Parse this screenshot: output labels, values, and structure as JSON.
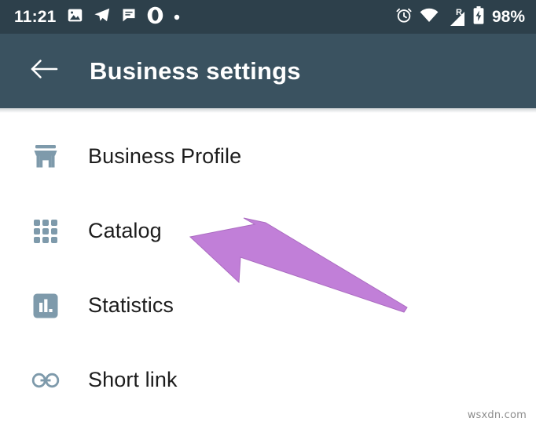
{
  "status_bar": {
    "time": "11:21",
    "battery_percent": "98%",
    "roaming_label": "R",
    "left_icons": [
      "photo-icon",
      "telegram-icon",
      "message-icon",
      "opera-icon",
      "dot-icon"
    ],
    "right_icons": [
      "alarm-icon",
      "wifi-icon",
      "signal-icon",
      "battery-charging-icon"
    ],
    "background_color": "#2d404b"
  },
  "app_bar": {
    "back_icon": "arrow-left-icon",
    "title": "Business settings",
    "background_color": "#3a5260",
    "text_color": "#ffffff"
  },
  "list": {
    "icon_color": "#7e9aab",
    "text_color": "#1d1d1d",
    "items": [
      {
        "label": "Business Profile",
        "icon": "storefront-icon"
      },
      {
        "label": "Catalog",
        "icon": "grid-dots-icon"
      },
      {
        "label": "Statistics",
        "icon": "bar-chart-icon"
      },
      {
        "label": "Short link",
        "icon": "link-icon"
      }
    ]
  },
  "annotation": {
    "arrow": {
      "name": "pointer-arrow",
      "color": "#c17fd8",
      "points_to": "Catalog"
    }
  },
  "watermark": {
    "text": "wsxdn.com"
  }
}
